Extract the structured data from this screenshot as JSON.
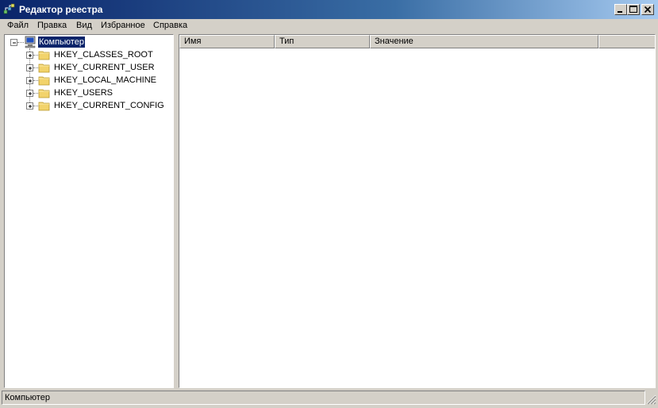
{
  "window": {
    "title": "Редактор реестра"
  },
  "menu": {
    "items": [
      "Файл",
      "Правка",
      "Вид",
      "Избранное",
      "Справка"
    ]
  },
  "tree": {
    "root": "Компьютер",
    "children": [
      "HKEY_CLASSES_ROOT",
      "HKEY_CURRENT_USER",
      "HKEY_LOCAL_MACHINE",
      "HKEY_USERS",
      "HKEY_CURRENT_CONFIG"
    ]
  },
  "list": {
    "columns": [
      "Имя",
      "Тип",
      "Значение"
    ]
  },
  "status": {
    "path": "Компьютер"
  },
  "colors": {
    "face": "#d4d0c8",
    "title_start": "#0a246a",
    "title_end": "#a6caf0",
    "selection": "#0a246a",
    "folder": "#f2d36b"
  },
  "icons": [
    "regedit-icon",
    "minimize-icon",
    "maximize-icon",
    "close-icon",
    "computer-icon",
    "folder-icon",
    "expand-icon",
    "collapse-icon",
    "size-grip-icon"
  ]
}
